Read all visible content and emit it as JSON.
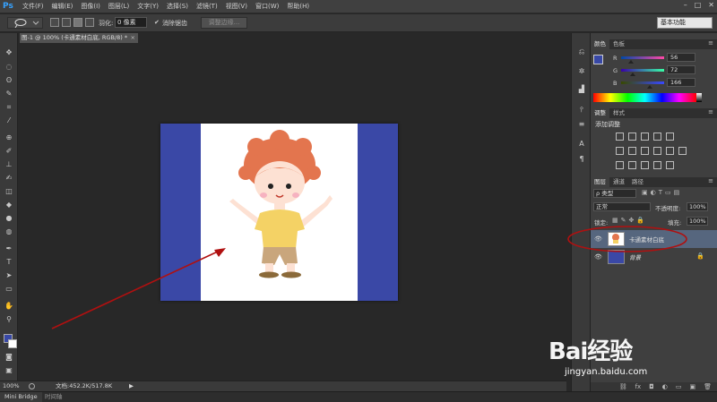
{
  "app": {
    "logo": "Ps",
    "menu": [
      "文件(F)",
      "编辑(E)",
      "图像(I)",
      "图层(L)",
      "文字(Y)",
      "选择(S)",
      "滤镜(T)",
      "视图(V)",
      "窗口(W)",
      "帮助(H)"
    ],
    "window_controls": [
      "–",
      "□",
      "✕"
    ]
  },
  "options_bar": {
    "feather_label": "羽化:",
    "feather_value": "0 像素",
    "antialias_label": "消除锯齿",
    "refine_edge_label": "调整边缘...",
    "workspace": "基本功能"
  },
  "document": {
    "tab_title": "卡通素材白底.jpg @ 100% (卡通素材白底, RGB/8) *",
    "tab_title_visible": "图-1 @ 100% (卡通素材白底, RGB/8) *",
    "close": "×"
  },
  "status": {
    "zoom": "100%",
    "doc_info": "文档:452.2K/517.8K",
    "arrow": "▶"
  },
  "bottom_tabs": [
    "Mini Bridge",
    "时间轴"
  ],
  "color_panel": {
    "tabs": [
      "颜色",
      "色板"
    ],
    "r_label": "R",
    "r_value": "56",
    "g_label": "G",
    "g_value": "72",
    "b_label": "B",
    "b_value": "166",
    "foreground_color": "#3848a6",
    "background_color": "#ffffff"
  },
  "adjustments_panel": {
    "tabs": [
      "调整",
      "样式"
    ],
    "heading": "添加调整"
  },
  "layers_panel": {
    "tabs": [
      "图层",
      "通道",
      "路径"
    ],
    "filter_label": "ρ 类型",
    "blend_mode": "正常",
    "opacity_label": "不透明度:",
    "opacity_value": "100%",
    "lock_label": "锁定:",
    "fill_label": "填充:",
    "fill_value": "100%",
    "layers": [
      {
        "name": "卡通素材白底",
        "visible": true,
        "selected": true
      },
      {
        "name": "背景",
        "visible": true,
        "selected": false
      }
    ],
    "footer_icons": [
      "⛓",
      "fx",
      "◘",
      "◐",
      "▭",
      "▣",
      "🗑"
    ]
  },
  "watermark": {
    "brand": "Bai经验",
    "url": "jingyan.baidu.com"
  },
  "colors": {
    "accent_blue": "#3a48a6",
    "annotation_red": "#b01010"
  }
}
